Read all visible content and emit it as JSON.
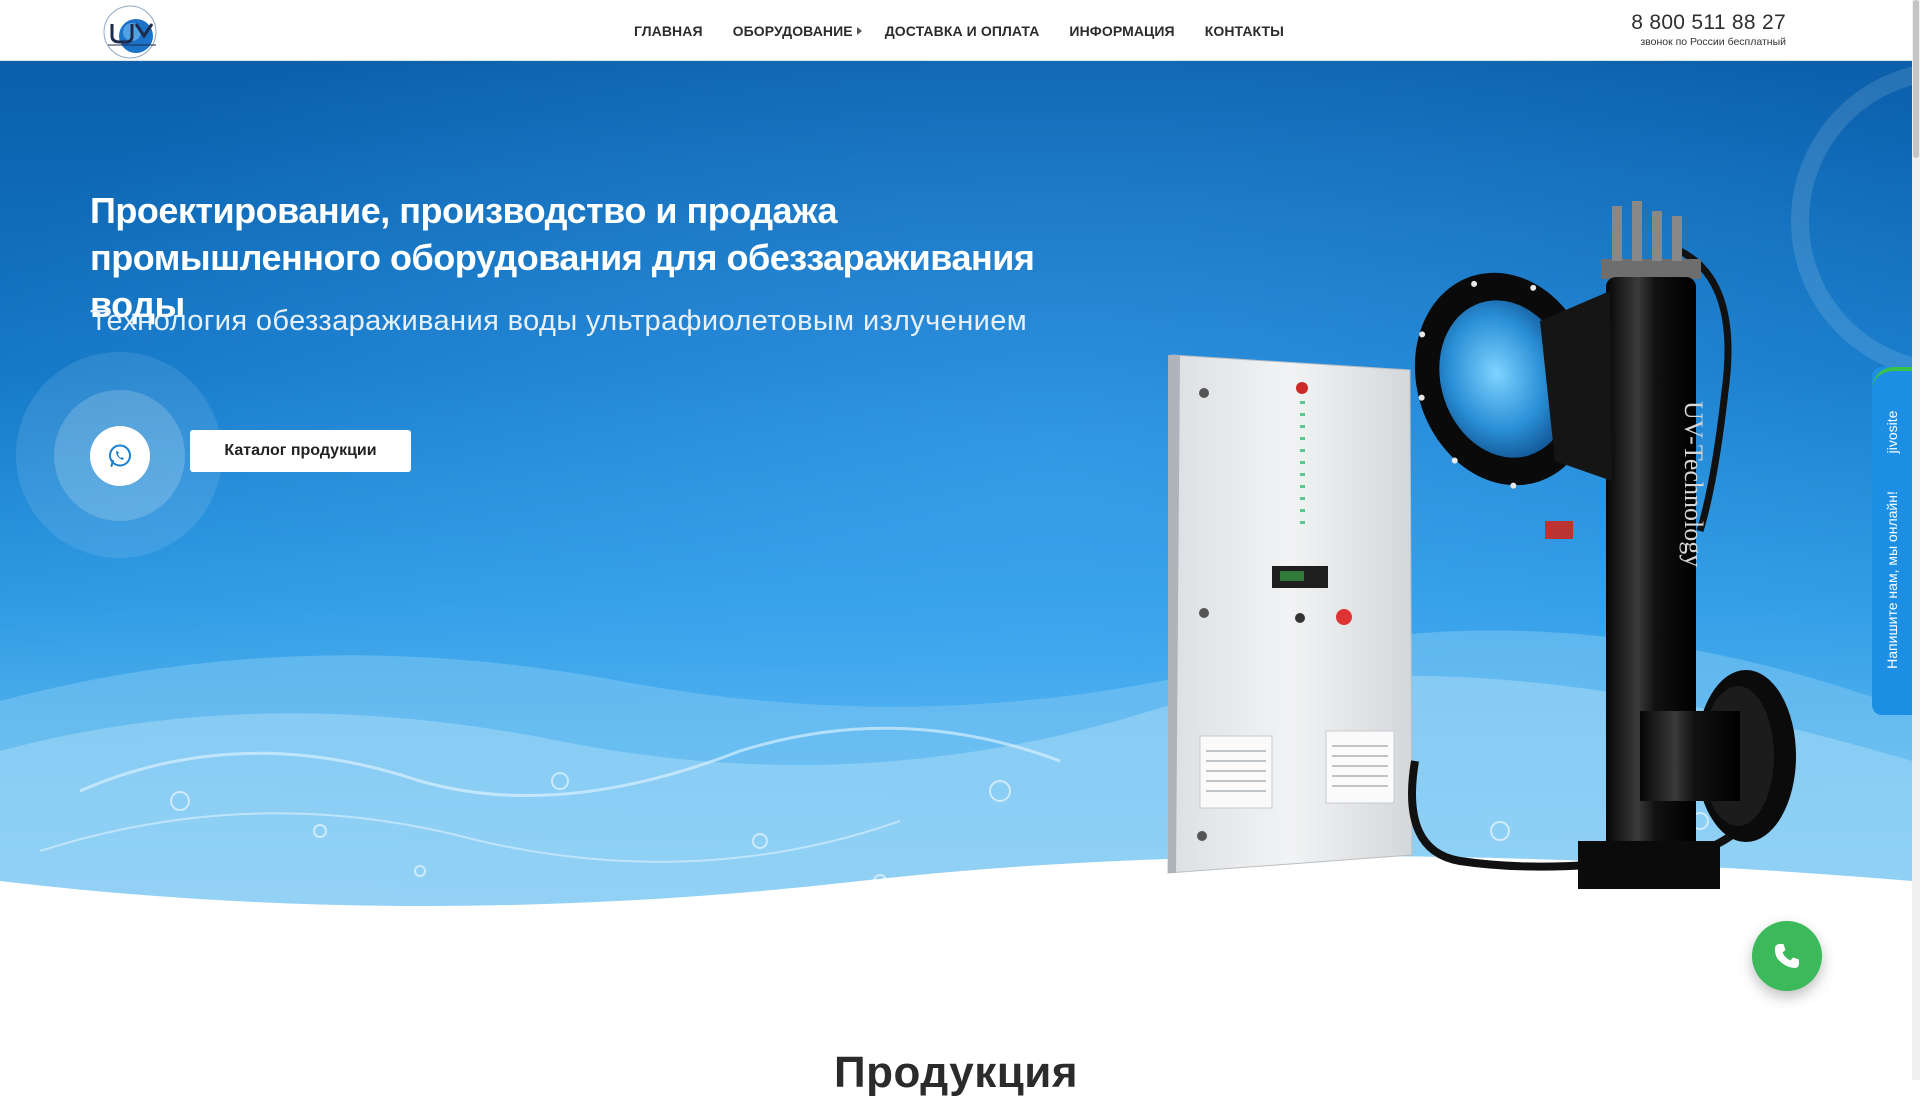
{
  "header": {
    "logo_alt": "UV-technology logo",
    "nav": [
      {
        "label": "Главная",
        "has_submenu": false
      },
      {
        "label": "Оборудование",
        "has_submenu": true
      },
      {
        "label": "Доставка и оплата",
        "has_submenu": false
      },
      {
        "label": "Информация",
        "has_submenu": false
      },
      {
        "label": "Контакты",
        "has_submenu": false
      }
    ],
    "phone": "8 800 511 88 27",
    "phone_note": "звонок по России бесплатный"
  },
  "hero": {
    "title": "Проектирование, производство и продажа промышленного оборудования для обеззараживания воды",
    "subtitle": "Технология обеззараживания воды ультрафиолетовым излучением",
    "catalog_button": "Каталог продукции",
    "whatsapp_icon": "whatsapp-icon",
    "product_label": "UV-Technology"
  },
  "chat_widget": {
    "brand": "jivosite",
    "message": "Напишите нам, мы онлайн!"
  },
  "call_button_icon": "phone-icon",
  "products": {
    "heading": "Продукция"
  },
  "colors": {
    "hero_blue": "#0a63b0",
    "call_green": "#3cb95a",
    "chat_blue": "#1c8fe5"
  }
}
